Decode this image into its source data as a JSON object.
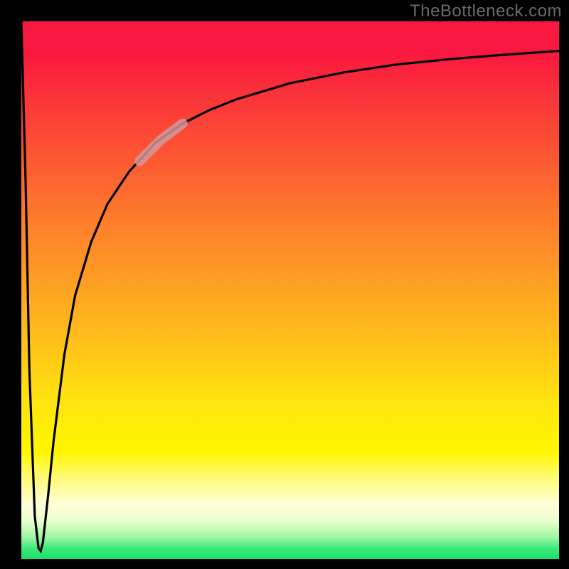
{
  "watermark": "TheBottleneck.com",
  "chart_data": {
    "type": "line",
    "title": "",
    "xlabel": "",
    "ylabel": "",
    "xlim": [
      0,
      100
    ],
    "ylim": [
      0,
      100
    ],
    "grid": false,
    "legend": false,
    "annotations": [],
    "background_gradient": {
      "direction": "vertical",
      "stops": [
        {
          "pos": 0.0,
          "color": "#f9183f"
        },
        {
          "pos": 0.26,
          "color": "#fc5a32"
        },
        {
          "pos": 0.56,
          "color": "#ffb51e"
        },
        {
          "pos": 0.8,
          "color": "#fff600"
        },
        {
          "pos": 0.93,
          "color": "#e8ffcc"
        },
        {
          "pos": 1.0,
          "color": "#18e06a"
        }
      ]
    },
    "series": [
      {
        "name": "bottleneck-curve",
        "color": "#000000",
        "x": [
          0.0,
          0.8,
          1.5,
          2.5,
          3.2,
          3.6,
          4.0,
          5.0,
          6.0,
          8.0,
          10.0,
          13.0,
          16.0,
          20.0,
          25.0,
          30.0,
          35.0,
          40.0,
          50.0,
          60.0,
          70.0,
          80.0,
          90.0,
          100.0
        ],
        "y": [
          100.0,
          70.0,
          35.0,
          8.0,
          2.0,
          1.5,
          3.0,
          12.0,
          22.0,
          38.0,
          49.0,
          59.0,
          66.0,
          72.0,
          77.5,
          81.0,
          83.5,
          85.5,
          88.5,
          90.5,
          92.0,
          93.0,
          93.8,
          94.5
        ]
      },
      {
        "name": "highlight-segment",
        "color": "#d39aa0",
        "thickness": "thick",
        "x": [
          22.0,
          24.0,
          26.0,
          28.0,
          30.0
        ],
        "y": [
          74.0,
          76.0,
          78.0,
          79.5,
          81.0
        ]
      }
    ]
  }
}
